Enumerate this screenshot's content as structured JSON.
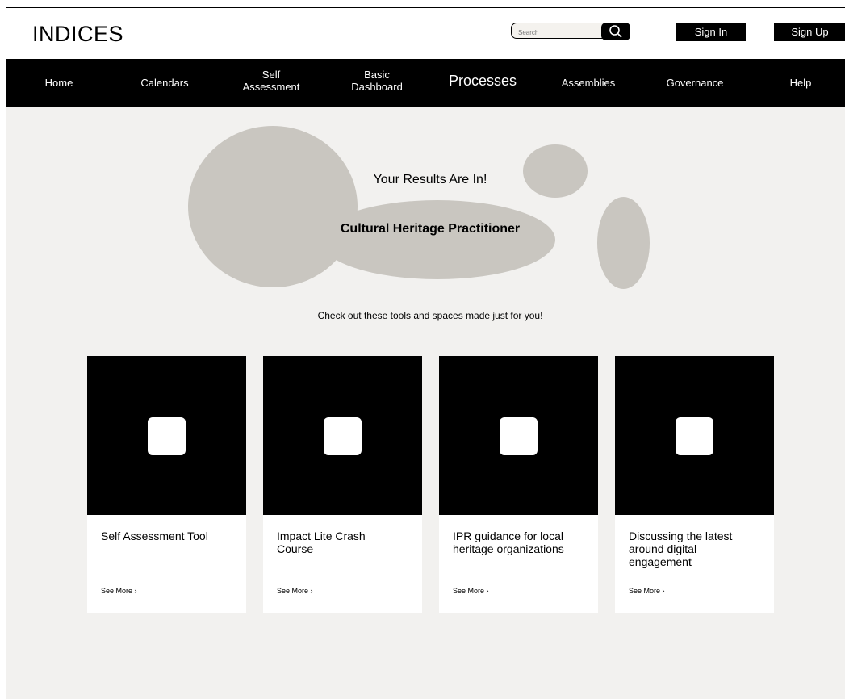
{
  "header": {
    "logo": "INDICES",
    "search_placeholder": "Search",
    "sign_in": "Sign In",
    "sign_up": "Sign Up"
  },
  "nav": {
    "items": [
      {
        "label": "Home"
      },
      {
        "label": "Calendars"
      },
      {
        "label": "Self\nAssessment"
      },
      {
        "label": "Basic\nDashboard"
      },
      {
        "label": "Processes"
      },
      {
        "label": "Assemblies"
      },
      {
        "label": "Governance"
      },
      {
        "label": "Help"
      }
    ]
  },
  "hero": {
    "title": "Your Results Are In!",
    "role": "Cultural Heritage Practitioner"
  },
  "subtitle": "Check out these tools and spaces  made just for you!",
  "cards": [
    {
      "title": "Self Assessment Tool",
      "link": "See More ›"
    },
    {
      "title": "Impact Lite Crash Course",
      "link": "See More ›"
    },
    {
      "title": "IPR guidance for local heritage organizations",
      "link": "See More ›"
    },
    {
      "title": "Discussing the latest around digital engagement",
      "link": "See More ›"
    }
  ],
  "colors": {
    "background": "#f2f1ef",
    "nav": "#000000",
    "shapes": "#c9c6c0"
  },
  "icons": {
    "search": "search-icon",
    "card": "card-icon"
  }
}
